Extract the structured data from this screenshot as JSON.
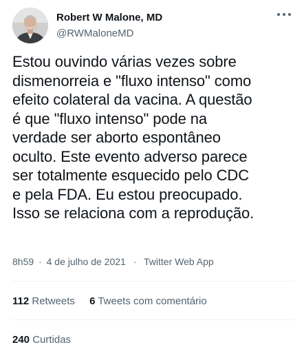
{
  "author": {
    "name": "Robert W Malone, MD",
    "handle": "@RWMaloneMD",
    "avatar_icon": "profile-photo"
  },
  "menu_icon": "more-options-icon",
  "tweet": {
    "text": "Estou ouvindo várias vezes sobre\ndismenorreia e \"fluxo intenso\" como\nefeito colateral da vacina. A questão\né que \"fluxo intenso\" pode na\nverdade ser aborto espontâneo\noculto. Este evento adverso parece\nser totalmente esquecido pelo CDC\ne pela FDA. Eu estou preocupado.\nIsso se relaciona com a reprodução."
  },
  "meta": {
    "time": "8h59",
    "date": "4 de julho de 2021",
    "separator": "·",
    "source": "Twitter Web App"
  },
  "stats": {
    "retweets_count": "112",
    "retweets_label": "Retweets",
    "quotes_count": "6",
    "quotes_label": "Tweets com comentário",
    "likes_count": "240",
    "likes_label": "Curtidas"
  },
  "colors": {
    "text": "#0f1419",
    "secondary": "#536471",
    "divider": "#eff3f4"
  }
}
